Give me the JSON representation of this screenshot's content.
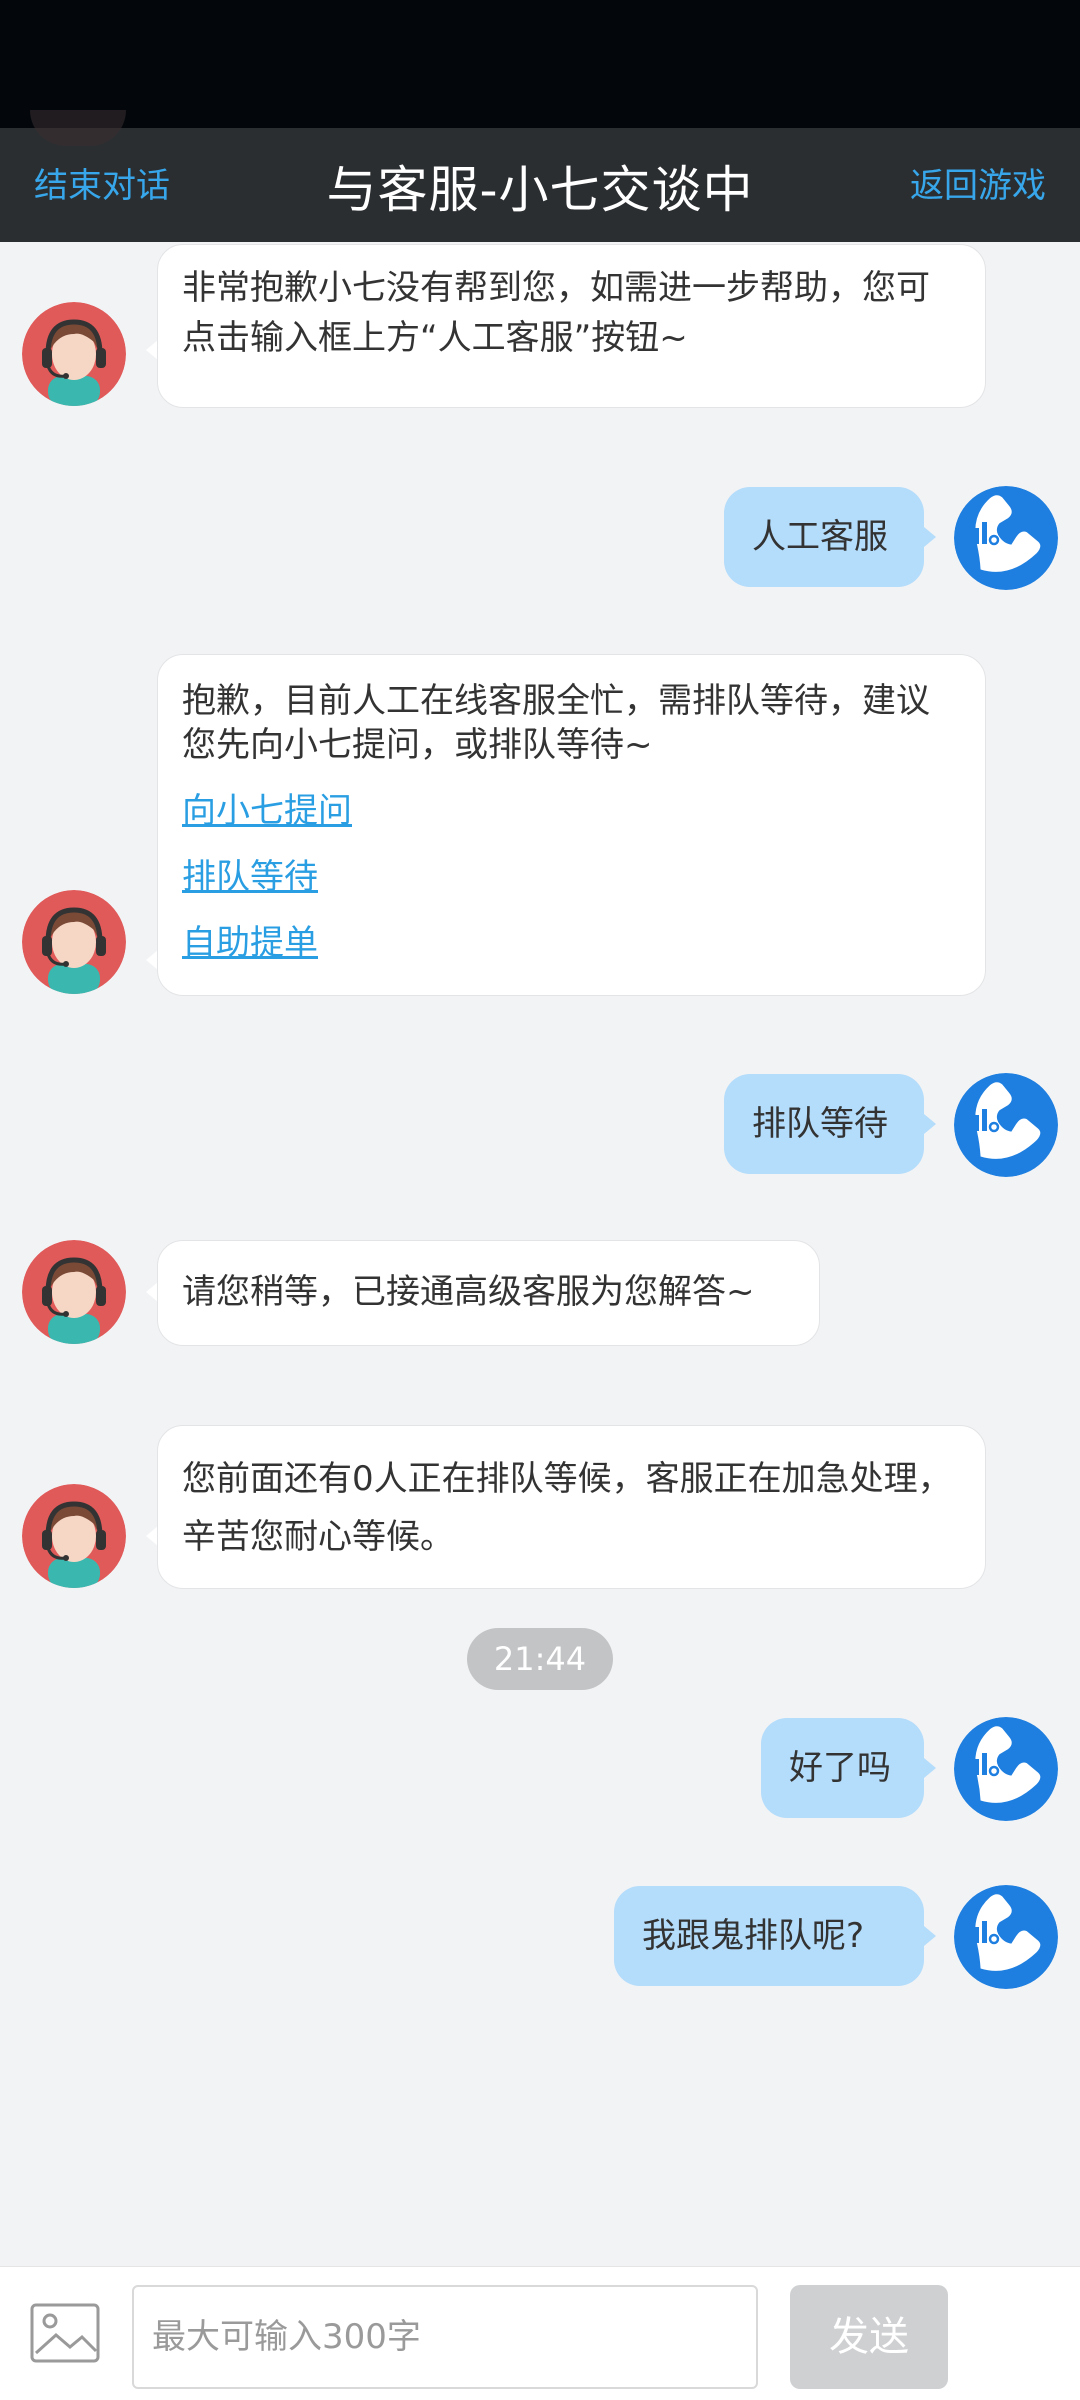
{
  "header": {
    "left_label": "结束对话",
    "title": "与客服-小七交谈中",
    "right_label": "返回游戏"
  },
  "messages": [
    {
      "from": "bot",
      "text": "非常抱歉小七没有帮到您，如需进一步帮助，您可点击输入框上方“人工客服”按钮~"
    },
    {
      "from": "user",
      "text": "人工客服"
    },
    {
      "from": "bot",
      "text": "抱歉，目前人工在线客服全忙，需排队等待，建议您先向小七提问，或排队等待~",
      "links": [
        "向小七提问",
        "排队等待",
        "自助提单"
      ]
    },
    {
      "from": "user",
      "text": "排队等待"
    },
    {
      "from": "bot",
      "text": "请您稍等，已接通高级客服为您解答~"
    },
    {
      "from": "bot",
      "text": "您前面还有0人正在排队等候，客服正在加急处理，辛苦您耐心等候。"
    },
    {
      "timestamp": "21:44"
    },
    {
      "from": "user",
      "text": "好了吗"
    },
    {
      "from": "user",
      "text": "我跟鬼排队呢?"
    }
  ],
  "footer": {
    "input_placeholder": "最大可输入300字",
    "send_label": "发送"
  },
  "colors": {
    "header_bg": "#2b2e31",
    "accent_link": "#37a6ea",
    "user_bubble": "#b4dcfb",
    "bot_bubble": "#ffffff",
    "page_bg": "#f2f3f5"
  },
  "icons": {
    "bot_avatar": "agent-headset-avatar-icon",
    "user_avatar": "blue-phone-avatar-icon",
    "image_button": "image-icon"
  }
}
